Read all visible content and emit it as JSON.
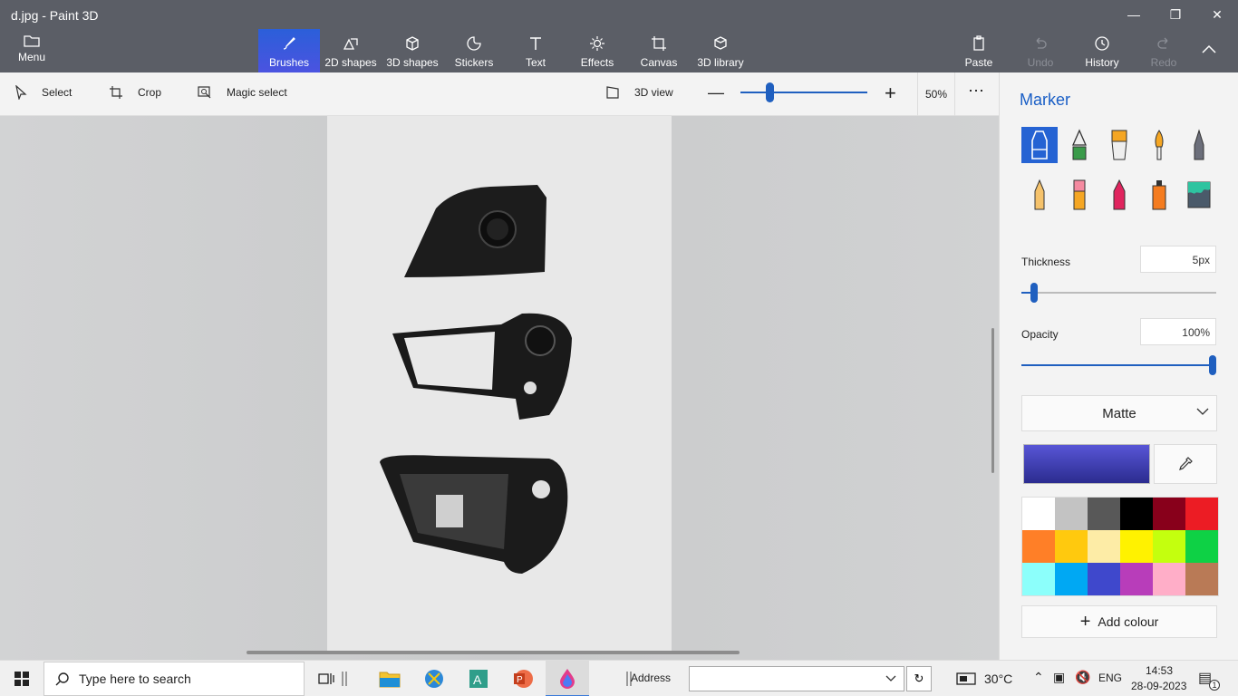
{
  "window": {
    "title": "d.jpg - Paint 3D"
  },
  "ribbon": {
    "menu_label": "Menu",
    "tools": [
      {
        "label": "Brushes"
      },
      {
        "label": "2D shapes"
      },
      {
        "label": "3D shapes"
      },
      {
        "label": "Stickers"
      },
      {
        "label": "Text"
      },
      {
        "label": "Effects"
      },
      {
        "label": "Canvas"
      },
      {
        "label": "3D library"
      }
    ],
    "paste_label": "Paste",
    "undo_label": "Undo",
    "history_label": "History",
    "redo_label": "Redo"
  },
  "toolbar": {
    "select_label": "Select",
    "crop_label": "Crop",
    "magic_select_label": "Magic select",
    "view_3d_label": "3D view",
    "zoom_percent": "50%",
    "zoom_level": 0.2
  },
  "panel": {
    "title": "Marker",
    "thickness_label": "Thickness",
    "thickness_value": "5px",
    "thickness_level": 0.05,
    "opacity_label": "Opacity",
    "opacity_value": "100%",
    "opacity_level": 1.0,
    "finish": "Matte",
    "add_colour_label": "Add colour",
    "palette": [
      "#ffffff",
      "#c3c3c3",
      "#585858",
      "#000000",
      "#88001b",
      "#ec1c24",
      "#ff7f27",
      "#ffc90e",
      "#fdeca6",
      "#fff200",
      "#c4ff0e",
      "#0ed145",
      "#8cfffb",
      "#00a8f3",
      "#3f48cc",
      "#b83dba",
      "#ffaec8",
      "#b97a56"
    ]
  },
  "taskbar": {
    "search_placeholder": "Type here to search",
    "address_label": "Address",
    "temperature": "30°C",
    "language": "ENG",
    "time": "14:53",
    "date": "28-09-2023",
    "notification_count": "1"
  }
}
